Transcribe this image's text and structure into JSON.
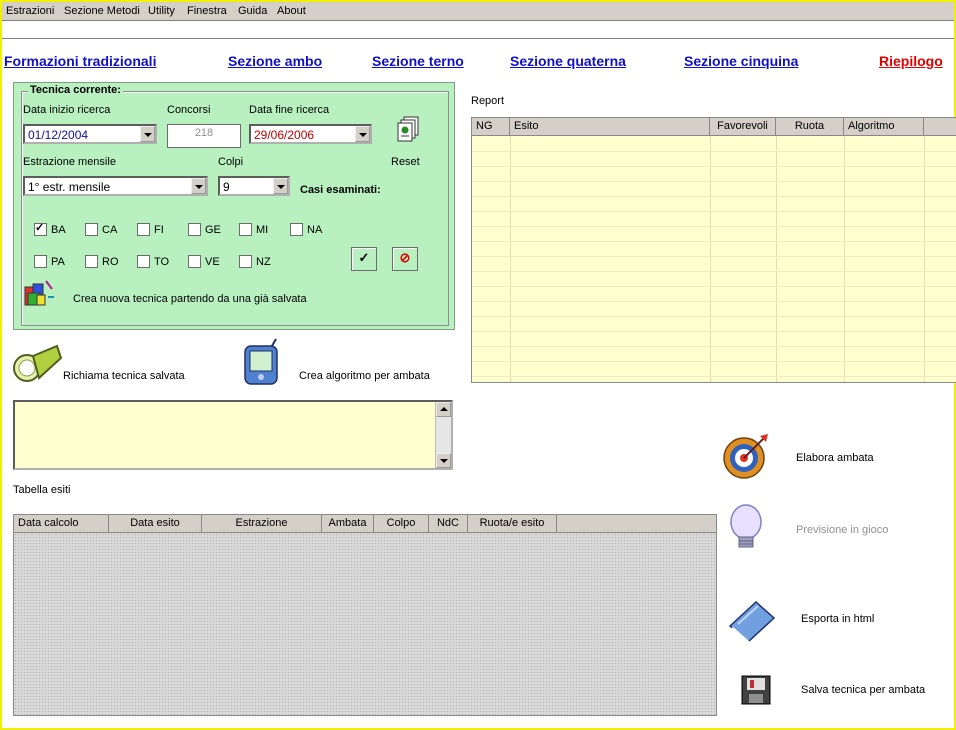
{
  "menu": [
    "Estrazioni",
    "Sezione Metodi",
    "Utility",
    "Finestra",
    "Guida",
    "About"
  ],
  "nav": {
    "formazioni": "Formazioni tradizionali",
    "ambo": "Sezione ambo",
    "terno": "Sezione terno",
    "quaterna": "Sezione quaterna",
    "cinquina": "Sezione cinquina",
    "riepilogo": "Riepilogo"
  },
  "panel": {
    "legend": "Tecnica corrente:",
    "data_inizio_label": "Data inizio ricerca",
    "data_inizio_value": "01/12/2004",
    "concorsi_label": "Concorsi",
    "concorsi_value": "218",
    "data_fine_label": "Data fine ricerca",
    "data_fine_value": "29/06/2006",
    "reset_label": "Reset",
    "estrazione_label": "Estrazione mensile",
    "estrazione_value": "1° estr. mensile",
    "colpi_label": "Colpi",
    "colpi_value": "9",
    "casi_label": "Casi esaminati:",
    "crea_nuova_label": "Crea nuova tecnica partendo da una già salvata",
    "ok_glyph": "✓",
    "cancel_glyph": "⊘"
  },
  "ruote": [
    {
      "label": "BA",
      "checked": true
    },
    {
      "label": "CA",
      "checked": false
    },
    {
      "label": "FI",
      "checked": false
    },
    {
      "label": "GE",
      "checked": false
    },
    {
      "label": "MI",
      "checked": false
    },
    {
      "label": "NA",
      "checked": false
    },
    {
      "label": "PA",
      "checked": false
    },
    {
      "label": "RO",
      "checked": false
    },
    {
      "label": "TO",
      "checked": false
    },
    {
      "label": "VE",
      "checked": false
    },
    {
      "label": "NZ",
      "checked": false
    }
  ],
  "actions": {
    "richiama": "Richiama tecnica salvata",
    "crea_algoritmo": "Crea algoritmo per ambata"
  },
  "report": {
    "title": "Report",
    "columns": [
      "NG",
      "Esito",
      "Favorevoli",
      "Ruota",
      "Algoritmo"
    ]
  },
  "tabella": {
    "title": "Tabella esiti",
    "columns": [
      "Data calcolo",
      "Data esito",
      "Estrazione",
      "Ambata",
      "Colpo",
      "NdC",
      "Ruota/e esito"
    ]
  },
  "side_actions": {
    "elabora": "Elabora ambata",
    "previsione": "Previsione in gioco",
    "esporta": "Esporta in html",
    "salva": "Salva tecnica per ambata"
  },
  "colors": {
    "panel_bg": "#b8f0c0",
    "grid_bg": "#ffffd0",
    "link": "#1010c8",
    "link_alert": "#e00000",
    "frame": "#f0f000"
  }
}
